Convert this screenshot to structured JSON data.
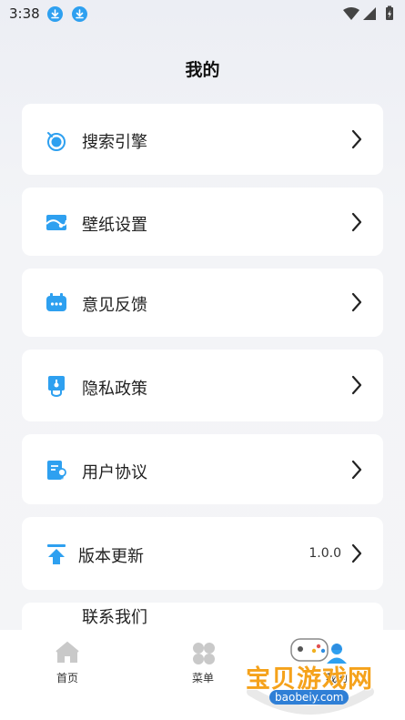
{
  "status_bar": {
    "time": "3:38"
  },
  "header": {
    "title": "我的"
  },
  "menu": {
    "items": [
      {
        "label": "搜索引擎",
        "icon": "search-engine-icon"
      },
      {
        "label": "壁纸设置",
        "icon": "wallpaper-icon"
      },
      {
        "label": "意见反馈",
        "icon": "feedback-icon"
      },
      {
        "label": "隐私政策",
        "icon": "privacy-lock-icon"
      },
      {
        "label": "用户协议",
        "icon": "user-agreement-icon"
      },
      {
        "label": "版本更新",
        "icon": "upload-arrow-icon",
        "value": "1.0.0"
      },
      {
        "label": "联系我们"
      }
    ]
  },
  "tab_bar": {
    "tabs": [
      {
        "label": "首页",
        "icon": "home-icon"
      },
      {
        "label": "菜单",
        "icon": "clover-menu-icon"
      },
      {
        "label": "我的",
        "icon": "profile-icon"
      }
    ]
  },
  "watermark": {
    "text": "宝贝游戏网",
    "url": "baobeiy.com"
  },
  "colors": {
    "accent": "#2ea0f0",
    "background": "#f4f5f7",
    "card": "#ffffff",
    "watermark_orange": "#f5a21b"
  }
}
